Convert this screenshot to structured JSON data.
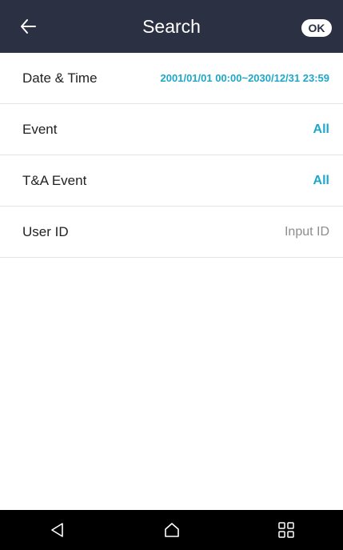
{
  "header": {
    "title": "Search",
    "ok_label": "OK"
  },
  "rows": [
    {
      "label": "Date & Time",
      "value": "2001/01/01 00:00~2030/12/31 23:59"
    },
    {
      "label": "Event",
      "value": "All"
    },
    {
      "label": "T&A Event",
      "value": "All"
    },
    {
      "label": "User ID",
      "value": "Input ID"
    }
  ],
  "colors": {
    "header_bg": "#2b3142",
    "accent": "#1ea7c7",
    "placeholder": "#8d8d8d"
  },
  "icons": {
    "back": "arrow-left-icon",
    "nav_back": "triangle-back-icon",
    "nav_home": "home-icon",
    "nav_apps": "grid-icon"
  }
}
